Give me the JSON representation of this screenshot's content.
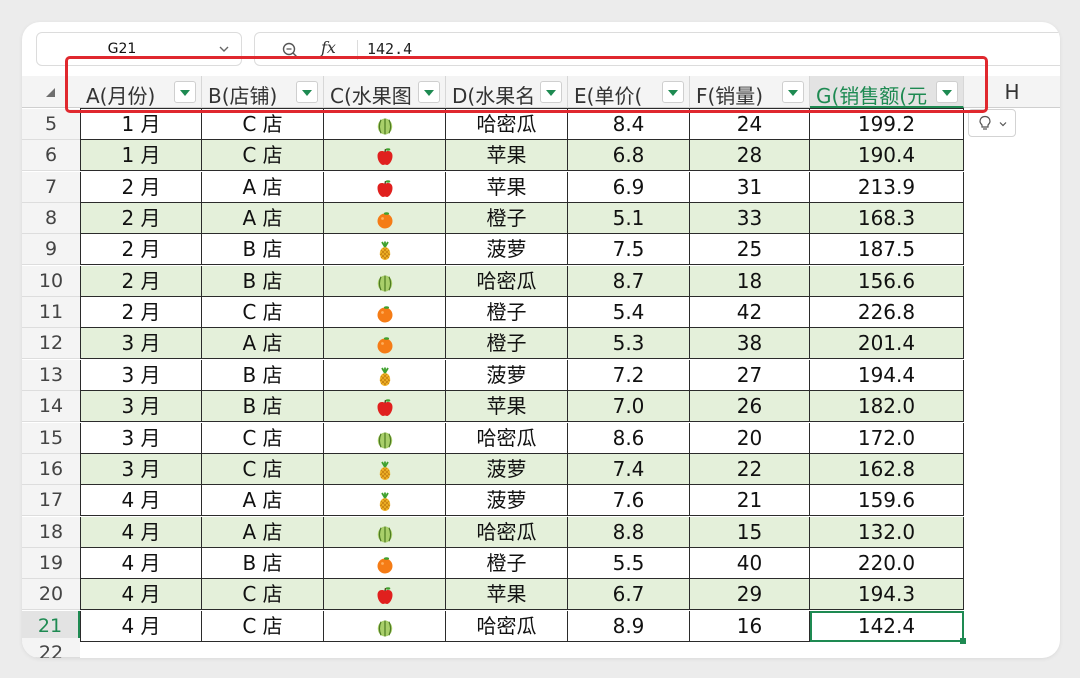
{
  "name_box": {
    "value": "G21"
  },
  "formula_bar": {
    "fx_label": "fx",
    "value": "142.4"
  },
  "columns": [
    {
      "label": "A(月份)",
      "filter": true
    },
    {
      "label": "B(店铺)",
      "filter": true
    },
    {
      "label": "C(水果图",
      "filter": true
    },
    {
      "label": "D(水果名",
      "filter": true
    },
    {
      "label": "E(单价(",
      "filter": true
    },
    {
      "label": "F(销量)",
      "filter": true
    },
    {
      "label": "G(销售额(元",
      "filter": true
    },
    {
      "label": "H",
      "filter": false
    }
  ],
  "rows": [
    {
      "num": "5",
      "month": "1 月",
      "store": "C 店",
      "fruit_icon": "melon-icon",
      "fruit": "哈密瓜",
      "price": "8.4",
      "qty": "24",
      "sales": "199.2"
    },
    {
      "num": "6",
      "month": "1 月",
      "store": "C 店",
      "fruit_icon": "apple-icon",
      "fruit": "苹果",
      "price": "6.8",
      "qty": "28",
      "sales": "190.4"
    },
    {
      "num": "7",
      "month": "2 月",
      "store": "A 店",
      "fruit_icon": "apple-icon",
      "fruit": "苹果",
      "price": "6.9",
      "qty": "31",
      "sales": "213.9"
    },
    {
      "num": "8",
      "month": "2 月",
      "store": "A 店",
      "fruit_icon": "orange-icon",
      "fruit": "橙子",
      "price": "5.1",
      "qty": "33",
      "sales": "168.3"
    },
    {
      "num": "9",
      "month": "2 月",
      "store": "B 店",
      "fruit_icon": "pineapple-icon",
      "fruit": "菠萝",
      "price": "7.5",
      "qty": "25",
      "sales": "187.5"
    },
    {
      "num": "10",
      "month": "2 月",
      "store": "B 店",
      "fruit_icon": "melon-icon",
      "fruit": "哈密瓜",
      "price": "8.7",
      "qty": "18",
      "sales": "156.6"
    },
    {
      "num": "11",
      "month": "2 月",
      "store": "C 店",
      "fruit_icon": "orange-icon",
      "fruit": "橙子",
      "price": "5.4",
      "qty": "42",
      "sales": "226.8"
    },
    {
      "num": "12",
      "month": "3 月",
      "store": "A 店",
      "fruit_icon": "orange-icon",
      "fruit": "橙子",
      "price": "5.3",
      "qty": "38",
      "sales": "201.4"
    },
    {
      "num": "13",
      "month": "3 月",
      "store": "B 店",
      "fruit_icon": "pineapple-icon",
      "fruit": "菠萝",
      "price": "7.2",
      "qty": "27",
      "sales": "194.4"
    },
    {
      "num": "14",
      "month": "3 月",
      "store": "B 店",
      "fruit_icon": "apple-icon",
      "fruit": "苹果",
      "price": "7.0",
      "qty": "26",
      "sales": "182.0"
    },
    {
      "num": "15",
      "month": "3 月",
      "store": "C 店",
      "fruit_icon": "melon-icon",
      "fruit": "哈密瓜",
      "price": "8.6",
      "qty": "20",
      "sales": "172.0"
    },
    {
      "num": "16",
      "month": "3 月",
      "store": "C 店",
      "fruit_icon": "pineapple-icon",
      "fruit": "菠萝",
      "price": "7.4",
      "qty": "22",
      "sales": "162.8"
    },
    {
      "num": "17",
      "month": "4 月",
      "store": "A 店",
      "fruit_icon": "pineapple-icon",
      "fruit": "菠萝",
      "price": "7.6",
      "qty": "21",
      "sales": "159.6"
    },
    {
      "num": "18",
      "month": "4 月",
      "store": "A 店",
      "fruit_icon": "melon-icon",
      "fruit": "哈密瓜",
      "price": "8.8",
      "qty": "15",
      "sales": "132.0"
    },
    {
      "num": "19",
      "month": "4 月",
      "store": "B 店",
      "fruit_icon": "orange-icon",
      "fruit": "橙子",
      "price": "5.5",
      "qty": "40",
      "sales": "220.0"
    },
    {
      "num": "20",
      "month": "4 月",
      "store": "C 店",
      "fruit_icon": "apple-icon",
      "fruit": "苹果",
      "price": "6.7",
      "qty": "29",
      "sales": "194.3"
    },
    {
      "num": "21",
      "month": "4 月",
      "store": "C 店",
      "fruit_icon": "melon-icon",
      "fruit": "哈密瓜",
      "price": "8.9",
      "qty": "16",
      "sales": "142.4"
    }
  ],
  "next_row_num": "22",
  "selection": {
    "row": "21",
    "column": "G"
  },
  "colors": {
    "accent": "#1e8a52",
    "band": "#e4f0da",
    "highlight": "#e0282e"
  }
}
